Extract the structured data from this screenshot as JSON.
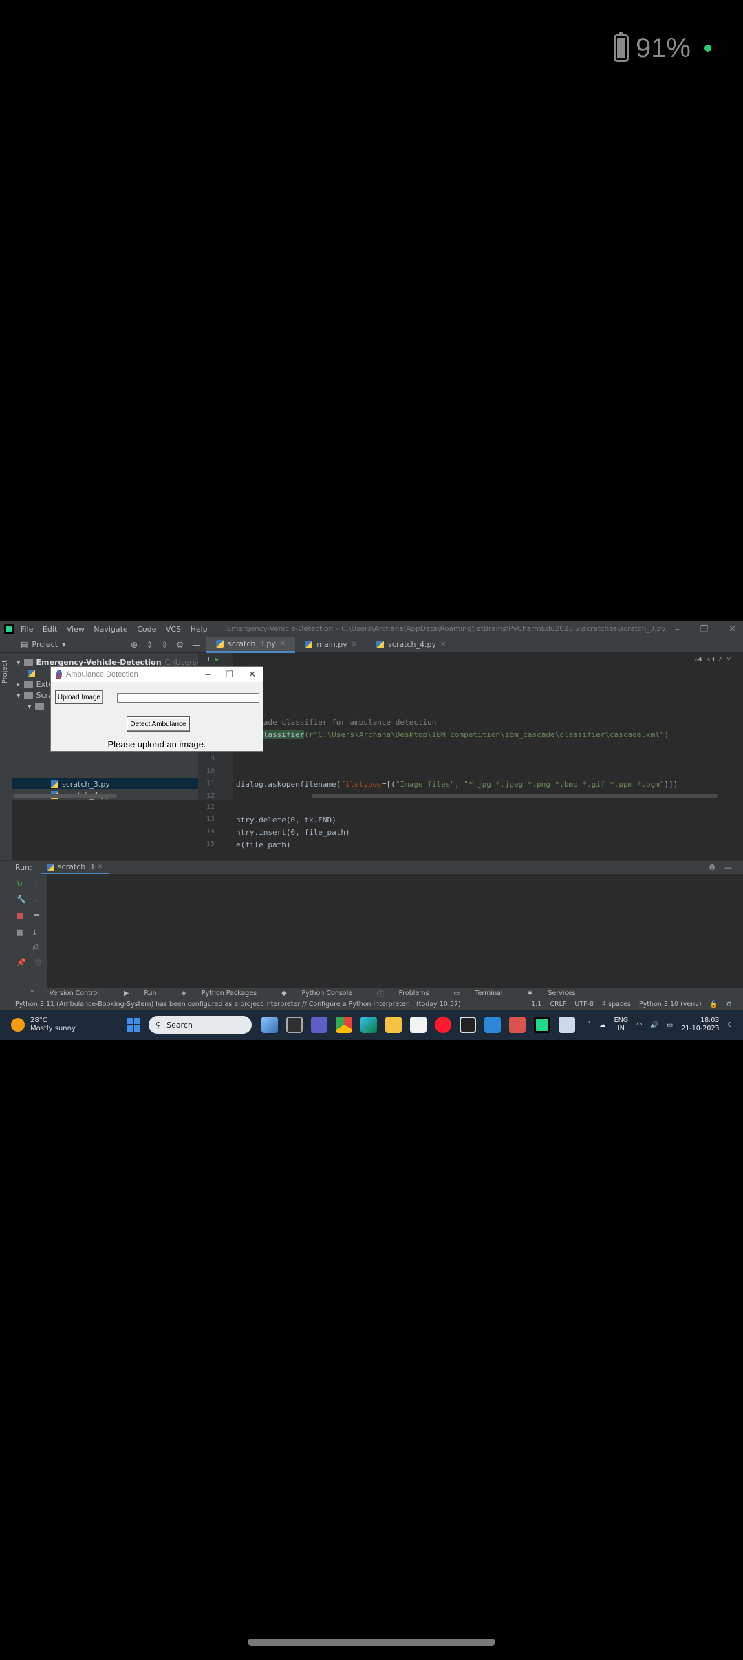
{
  "phone_status": {
    "battery_percent": "91%",
    "battery_level": 0.91,
    "dot_color": "#2ecc71"
  },
  "ide": {
    "menu": [
      "File",
      "Edit",
      "View",
      "Navigate",
      "Code",
      "VCS",
      "Help"
    ],
    "title_path": "Emergency-Vehicle-Detection – C:\\Users\\Archana\\AppData\\Roaming\\JetBrains\\PyCharmEdu2023.2\\scratches\\scratch_3.py",
    "project_label": "Project",
    "tabs": [
      {
        "label": "scratch_3.py",
        "active": true
      },
      {
        "label": "main.py",
        "active": false
      },
      {
        "label": "scratch_4.py",
        "active": false
      }
    ],
    "tree": {
      "root": "Emergency-Vehicle-Detection",
      "root_path": "C:\\Users\\Archana\\",
      "external": "Exte",
      "scratches": "Scra",
      "file1": "scratch_3.py",
      "file2": "scratch_4.py"
    },
    "editor": {
      "run_count": "1",
      "warnings": "4",
      "weak_warnings": "3",
      "line_numbers": [
        "9",
        "10",
        "11",
        "12",
        "13",
        "14",
        "15"
      ],
      "lines": {
        "l1": "ialog",
        "l2": "geTk",
        "l5": "r Cascade classifier for ambulance detection",
        "l6a": "scadeClassifier",
        "l6b": "(r\"C:\\Users\\Archana\\Desktop\\IBM competition\\ibm_cascade\\classifier\\cascade.xml\")",
        "l11a": "dialog.askopenfilename(",
        "l11b": "filetypes",
        "l11c": "=[(",
        "l11d": "\"Image files\", \"*.jpg *.jpeg *.png *.bmp *.gif *.ppm *.pgm\"",
        "l11e": ")])",
        "l13": "ntry.delete(0, tk.END)",
        "l14": "ntry.insert(0, file_path)",
        "l15": "e(file_path)"
      }
    },
    "run": {
      "label": "Run:",
      "tab": "scratch_3"
    },
    "bottom_tabs": [
      "Version Control",
      "Run",
      "Python Packages",
      "Python Console",
      "Problems",
      "Terminal",
      "Services"
    ],
    "status_message": "Python 3.11 (Ambulance-Booking-System) has been configured as a project interpreter // Configure a Python interpreter... (today 10:57)",
    "status_right": [
      "1:1",
      "CRLF",
      "UTF-8",
      "4 spaces",
      "Python 3.10 (venv)"
    ]
  },
  "taskbar": {
    "temp": "28°C",
    "weather": "Mostly sunny",
    "search": "Search",
    "lang1": "ENG",
    "lang2": "IN",
    "time": "18:03",
    "date": "21-10-2023"
  },
  "dialog": {
    "title": "Ambulance Detection",
    "upload_button": "Upload Image",
    "path_value": "",
    "detect_button": "Detect Ambulance",
    "message": "Please upload an image."
  }
}
